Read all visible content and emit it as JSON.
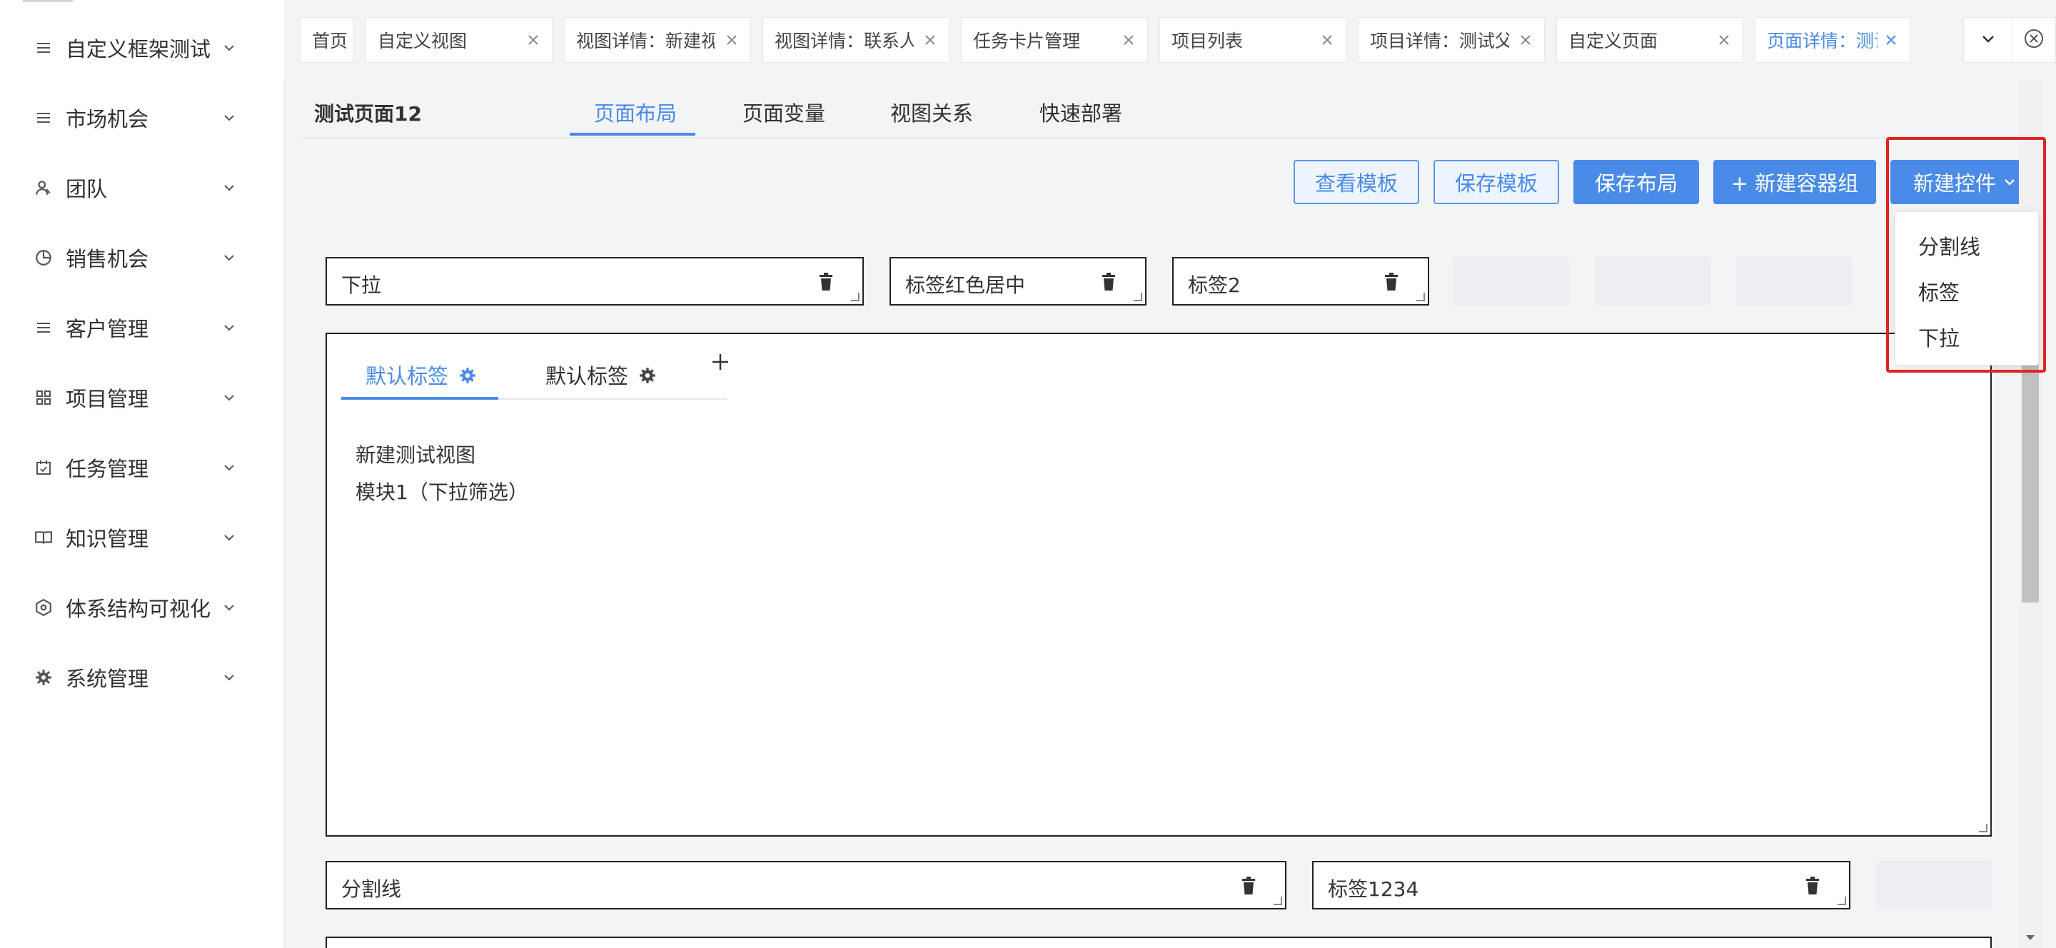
{
  "sidebar": {
    "items": [
      {
        "label": "自定义框架测试",
        "icon": "menu-lines-icon"
      },
      {
        "label": "市场机会",
        "icon": "menu-lines-icon"
      },
      {
        "label": "团队",
        "icon": "team-icon"
      },
      {
        "label": "销售机会",
        "icon": "pie-chart-icon"
      },
      {
        "label": "客户管理",
        "icon": "menu-lines-icon"
      },
      {
        "label": "项目管理",
        "icon": "grid-icon"
      },
      {
        "label": "任务管理",
        "icon": "calendar-check-icon"
      },
      {
        "label": "知识管理",
        "icon": "book-icon"
      },
      {
        "label": "体系结构可视化",
        "icon": "hexagon-network-icon"
      },
      {
        "label": "系统管理",
        "icon": "gear-icon"
      }
    ]
  },
  "tabs": [
    {
      "label": "首页",
      "closable": false,
      "active": false
    },
    {
      "label": "自定义视图",
      "closable": true,
      "active": false
    },
    {
      "label": "视图详情：新建视",
      "closable": true,
      "active": false
    },
    {
      "label": "视图详情：联系人",
      "closable": true,
      "active": false
    },
    {
      "label": "任务卡片管理",
      "closable": true,
      "active": false
    },
    {
      "label": "项目列表",
      "closable": true,
      "active": false
    },
    {
      "label": "项目详情：测试父",
      "closable": true,
      "active": false
    },
    {
      "label": "自定义页面",
      "closable": true,
      "active": false
    },
    {
      "label": "页面详情：测试页",
      "closable": true,
      "active": true
    }
  ],
  "page": {
    "title": "测试页面12",
    "tabs": [
      "页面布局",
      "页面变量",
      "视图关系",
      "快速部署"
    ],
    "active_tab": "页面布局"
  },
  "toolbar": {
    "view_template": "查看模板",
    "save_template": "保存模板",
    "save_layout": "保存布局",
    "new_container_group": "+ 新建容器组",
    "new_control": "新建控件"
  },
  "new_control_menu": {
    "items": [
      "分割线",
      "标签",
      "下拉"
    ]
  },
  "row1": {
    "controls": [
      "下拉",
      "标签红色居中",
      "标签2"
    ]
  },
  "container": {
    "tabs": [
      "默认标签",
      "默认标签"
    ],
    "active_tab_index": 0,
    "lines": [
      "新建测试视图",
      "模块1（下拉筛选）"
    ]
  },
  "row2": {
    "controls": [
      "分割线",
      "标签1234"
    ]
  },
  "colors": {
    "accent": "#4a8be8",
    "highlight": "#e02424"
  }
}
